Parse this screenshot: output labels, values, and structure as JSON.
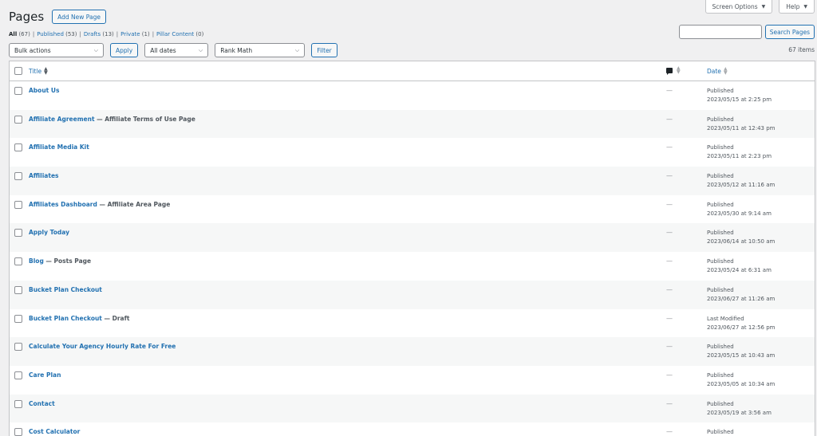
{
  "header": {
    "title": "Pages",
    "add_new": "Add New Page",
    "screen_options": "Screen Options",
    "help": "Help"
  },
  "views": [
    {
      "label": "All",
      "count": "(67)"
    },
    {
      "label": "Published",
      "count": "(53)"
    },
    {
      "label": "Drafts",
      "count": "(13)"
    },
    {
      "label": "Private",
      "count": "(1)"
    },
    {
      "label": "Pillar Content",
      "count": "(0)"
    }
  ],
  "search": {
    "button": "Search Pages",
    "value": ""
  },
  "tablenav": {
    "bulk": "Bulk actions",
    "apply": "Apply",
    "dates": "All dates",
    "rank": "Rank Math",
    "filter": "Filter",
    "items": "67 items"
  },
  "columns": {
    "title": "Title",
    "date": "Date"
  },
  "rows": [
    {
      "title": "About Us",
      "state": "",
      "dash": "—",
      "status": "Published",
      "date": "2023/05/15 at 2:25 pm"
    },
    {
      "title": "Affiliate Agreement",
      "state": " — Affiliate Terms of Use Page",
      "dash": "—",
      "status": "Published",
      "date": "2023/05/11 at 12:43 pm"
    },
    {
      "title": "Affiliate Media Kit",
      "state": "",
      "dash": "—",
      "status": "Published",
      "date": "2023/05/11 at 2:23 pm"
    },
    {
      "title": "Affiliates",
      "state": "",
      "dash": "—",
      "status": "Published",
      "date": "2023/05/12 at 11:16 am"
    },
    {
      "title": "Affiliates Dashboard",
      "state": " — Affiliate Area Page",
      "dash": "—",
      "status": "Published",
      "date": "2023/05/30 at 9:14 am"
    },
    {
      "title": "Apply Today",
      "state": "",
      "dash": "—",
      "status": "Published",
      "date": "2023/06/14 at 10:50 am"
    },
    {
      "title": "Blog",
      "state": " — Posts Page",
      "dash": "—",
      "status": "Published",
      "date": "2023/05/24 at 6:31 am"
    },
    {
      "title": "Bucket Plan Checkout",
      "state": "",
      "dash": "—",
      "status": "Published",
      "date": "2023/06/27 at 11:26 am"
    },
    {
      "title": "Bucket Plan Checkout",
      "state": " — Draft",
      "dash": "—",
      "status": "Last Modified",
      "date": "2023/06/27 at 12:56 pm"
    },
    {
      "title": "Calculate Your Agency Hourly Rate For Free",
      "state": "",
      "dash": "—",
      "status": "Published",
      "date": "2023/05/15 at 10:43 am"
    },
    {
      "title": "Care Plan",
      "state": "",
      "dash": "—",
      "status": "Published",
      "date": "2023/05/05 at 10:34 am"
    },
    {
      "title": "Contact",
      "state": "",
      "dash": "—",
      "status": "Published",
      "date": "2023/05/19 at 3:56 am"
    },
    {
      "title": "Cost Calculator",
      "state": "",
      "dash": "—",
      "status": "Published",
      "date": ""
    }
  ]
}
